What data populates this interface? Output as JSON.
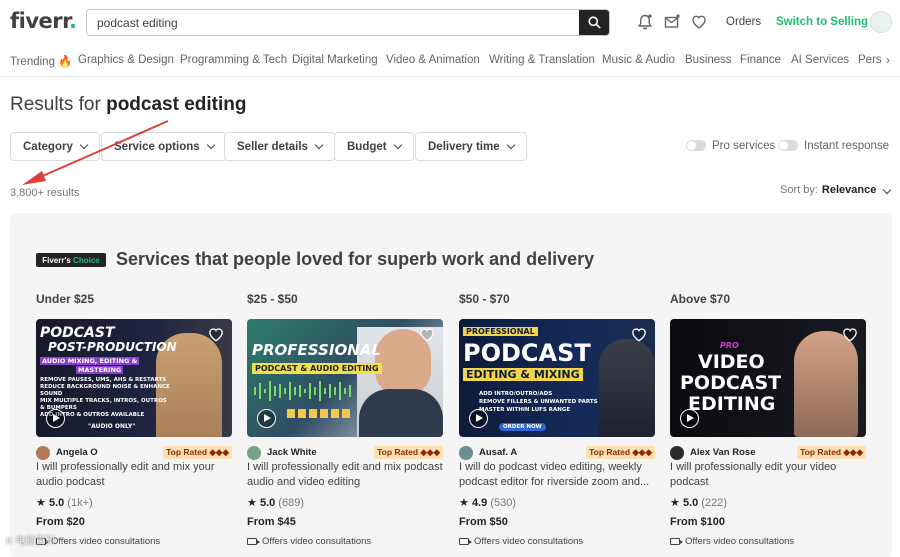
{
  "header": {
    "logo_text": "fiverr",
    "logo_dot": ".",
    "search_value": "podcast editing",
    "orders": "Orders",
    "switch_selling": "Switch to Selling",
    "brand_green": "#1dbf73"
  },
  "categories": [
    "Trending 🔥",
    "Graphics & Design",
    "Programming & Tech",
    "Digital Marketing",
    "Video & Animation",
    "Writing & Translation",
    "Music & Audio",
    "Business",
    "Finance",
    "AI Services",
    "Pers"
  ],
  "results": {
    "prefix": "Results for ",
    "query": "podcast editing",
    "count": "3,800+ results",
    "sort_label": "Sort by:",
    "sort_value": "Relevance"
  },
  "filters": [
    "Category",
    "Service options",
    "Seller details",
    "Budget",
    "Delivery time"
  ],
  "toggles": [
    "Pro services",
    "Instant response"
  ],
  "choice": {
    "badge_main": "Fiverr's",
    "badge_accent": "Choice",
    "title": "Services that people loved for superb work and delivery"
  },
  "columns": [
    "Under $25",
    "$25 - $50",
    "$50 - $70",
    "Above $70"
  ],
  "gigs": [
    {
      "thumb_lines": [
        "PODCAST",
        "POST-PRODUCTION",
        "AUDIO MIXING, EDITING &",
        "MASTERING",
        "REMOVE PAUSES, UMS, AHS & RESTARTS",
        "REDUCE BACKGROUND NOISE & ENHANCE",
        "SOUND",
        "MIX MULTIPLE TRACKS, INTROS, OUTROS",
        "& BUMPERS",
        "ADD INTRO & OUTROS AVAILABLE",
        "\"AUDIO ONLY\""
      ],
      "seller": "Angela O",
      "badge": "Top Rated ◆◆◆",
      "title": "I will professionally edit and mix your audio podcast",
      "rating": "5.0",
      "reviews": "(1k+)",
      "price": "From $20",
      "consult": "Offers video consultations"
    },
    {
      "thumb_lines": [
        "PROFESSIONAL",
        "PODCAST & AUDIO EDITING"
      ],
      "seller": "Jack White",
      "badge": "Top Rated ◆◆◆",
      "title": "I will professionally edit and mix podcast audio and video editing",
      "rating": "5.0",
      "reviews": "(689)",
      "price": "From $45",
      "consult": "Offers video consultations"
    },
    {
      "thumb_lines": [
        "PROFESSIONAL",
        "PODCAST",
        "EDITING & MIXING",
        "ADD INTRO/OUTRO/ADS",
        "REMOVE FILLERS & UNWANTED PARTS",
        "MASTER WITHIN LUFS RANGE",
        "ORDER NOW"
      ],
      "seller": "Ausaf. A",
      "badge": "Top Rated ◆◆◆",
      "title": "I will do podcast video editing, weekly podcast editor for riverside zoom and...",
      "rating": "4.9",
      "reviews": "(530)",
      "price": "From $50",
      "consult": "Offers video consultations"
    },
    {
      "thumb_lines": [
        "PRO",
        "VIDEO",
        "PODCAST",
        "EDITING"
      ],
      "seller": "Alex Van Rose",
      "badge": "Top Rated ◆◆◆",
      "title": "I will professionally edit your video podcast",
      "rating": "5.0",
      "reviews": "(222)",
      "price": "From $100",
      "consult": "Offers video consultations"
    }
  ],
  "icons": [
    "search-icon",
    "bell-icon",
    "message-icon",
    "heart-icon",
    "chevron-right-icon",
    "star-icon",
    "play-icon",
    "video-camera-icon"
  ],
  "watermark": "K 电脑百科"
}
